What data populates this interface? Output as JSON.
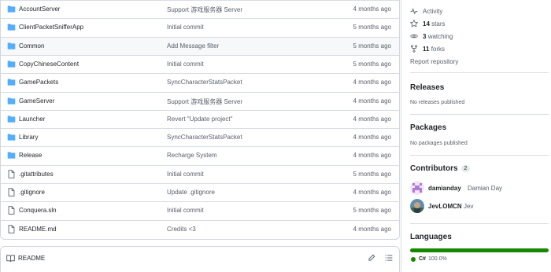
{
  "files": [
    {
      "name": "AccountServer",
      "type": "dir",
      "message": "Support 游戏服务器 Server",
      "time": "4 months ago",
      "highlight": false
    },
    {
      "name": "ClientPacketSnifferApp",
      "type": "dir",
      "message": "Initial commit",
      "time": "5 months ago",
      "highlight": false
    },
    {
      "name": "Common",
      "type": "dir",
      "message": "Add Message filter",
      "time": "5 months ago",
      "highlight": true
    },
    {
      "name": "CopyChineseContent",
      "type": "dir",
      "message": "Initial commit",
      "time": "5 months ago",
      "highlight": false
    },
    {
      "name": "GamePackets",
      "type": "dir",
      "message": "SyncCharacterStatsPacket",
      "time": "4 months ago",
      "highlight": false
    },
    {
      "name": "GameServer",
      "type": "dir",
      "message": "Support 游戏服务器 Server",
      "time": "4 months ago",
      "highlight": false
    },
    {
      "name": "Launcher",
      "type": "dir",
      "message": "Revert \"Update project\"",
      "time": "4 months ago",
      "highlight": false
    },
    {
      "name": "Library",
      "type": "dir",
      "message": "SyncCharacterStatsPacket",
      "time": "4 months ago",
      "highlight": false
    },
    {
      "name": "Release",
      "type": "dir",
      "message": "Recharge System",
      "time": "4 months ago",
      "highlight": false
    },
    {
      "name": ".gitattributes",
      "type": "file",
      "message": "Initial commit",
      "time": "5 months ago",
      "highlight": false
    },
    {
      "name": ".gitignore",
      "type": "file",
      "message": "Update .gitignore",
      "time": "4 months ago",
      "highlight": false
    },
    {
      "name": "Conquera.sln",
      "type": "file",
      "message": "Initial commit",
      "time": "5 months ago",
      "highlight": false
    },
    {
      "name": "README.md",
      "type": "file",
      "message": "Credits <3",
      "time": "4 months ago",
      "highlight": false
    }
  ],
  "readme": {
    "label": "README"
  },
  "sidebar": {
    "activity": "Activity",
    "stars_count": "14",
    "stars_label": "stars",
    "watching_count": "3",
    "watching_label": "watching",
    "forks_count": "11",
    "forks_label": "forks",
    "report": "Report repository",
    "releases_title": "Releases",
    "releases_empty": "No releases published",
    "packages_title": "Packages",
    "packages_empty": "No packages published",
    "contributors_title": "Contributors",
    "contributors_count": "2",
    "contributors": [
      {
        "login": "damianday",
        "name": "Damian Day"
      },
      {
        "login": "JevLOMCN",
        "name": "Jev"
      }
    ],
    "languages_title": "Languages",
    "language": {
      "name": "C#",
      "percent": "100.0%",
      "color": "#178600"
    }
  },
  "colors": {
    "folder": "#54aeff",
    "link_blue": "#0969da",
    "border": "#d0d7de"
  }
}
